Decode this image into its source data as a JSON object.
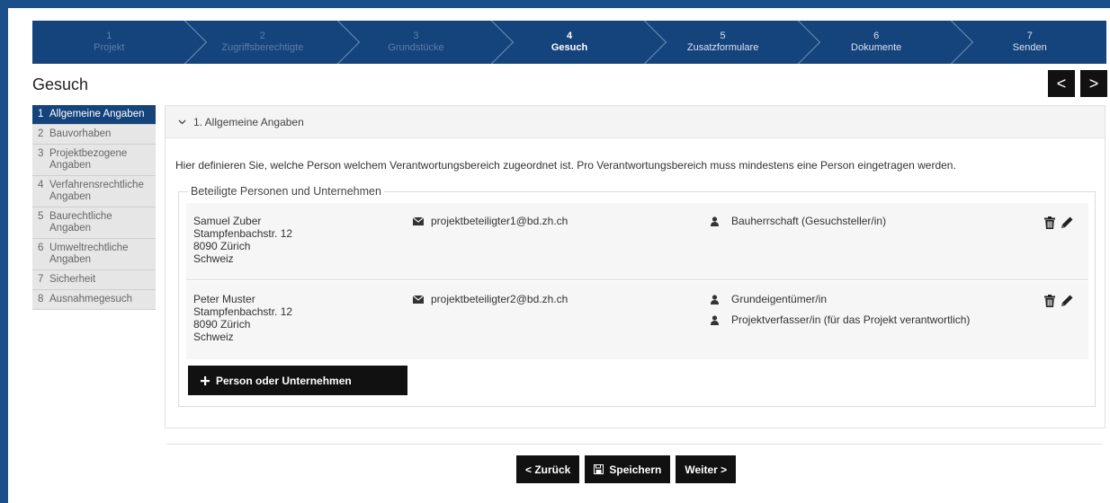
{
  "stepper": {
    "steps": [
      {
        "num": "1",
        "label": "Projekt",
        "state": "disabled"
      },
      {
        "num": "2",
        "label": "Zugriffsberechtigte",
        "state": "disabled"
      },
      {
        "num": "3",
        "label": "Grundstücke",
        "state": "disabled"
      },
      {
        "num": "4",
        "label": "Gesuch",
        "state": "active"
      },
      {
        "num": "5",
        "label": "Zusatzformulare",
        "state": "todo"
      },
      {
        "num": "6",
        "label": "Dokumente",
        "state": "todo"
      },
      {
        "num": "7",
        "label": "Senden",
        "state": "todo"
      }
    ]
  },
  "page": {
    "title": "Gesuch",
    "prev_label": "<",
    "next_label": ">"
  },
  "sidebar": {
    "items": [
      {
        "num": "1",
        "label": "Allgemeine Angaben"
      },
      {
        "num": "2",
        "label": "Bauvorhaben"
      },
      {
        "num": "3",
        "label": "Projektbezogene Angaben"
      },
      {
        "num": "4",
        "label": "Verfahrensrechtliche Angaben"
      },
      {
        "num": "5",
        "label": "Baurechtliche Angaben"
      },
      {
        "num": "6",
        "label": "Umweltrechtliche Angaben"
      },
      {
        "num": "7",
        "label": "Sicherheit"
      },
      {
        "num": "8",
        "label": "Ausnahmegesuch"
      }
    ]
  },
  "section": {
    "title": "1. Allgemeine Angaben",
    "description": "Hier definieren Sie, welche Person welchem Verantwortungsbereich zugeordnet ist. Pro Verantwortungsbereich muss mindestens eine Person eingetragen werden.",
    "legend": "Beteiligte Personen und Unternehmen"
  },
  "persons": [
    {
      "name": "Samuel Zuber",
      "street": "Stampfenbachstr. 12",
      "city": "8090 Zürich",
      "country": "Schweiz",
      "email": "projektbeteiligter1@bd.zh.ch",
      "roles": [
        "Bauherrschaft (Gesuchsteller/in)"
      ]
    },
    {
      "name": "Peter Muster",
      "street": "Stampfenbachstr. 12",
      "city": "8090 Zürich",
      "country": "Schweiz",
      "email": "projektbeteiligter2@bd.zh.ch",
      "roles": [
        "Grundeigentümer/in",
        "Projektverfasser/in (für das Projekt verantwortlich)"
      ]
    }
  ],
  "buttons": {
    "add_person": "Person oder Unternehmen",
    "back": "< Zurück",
    "save": "Speichern",
    "next": "Weiter >"
  },
  "colors": {
    "brand": "#15447c",
    "button": "#111111"
  }
}
